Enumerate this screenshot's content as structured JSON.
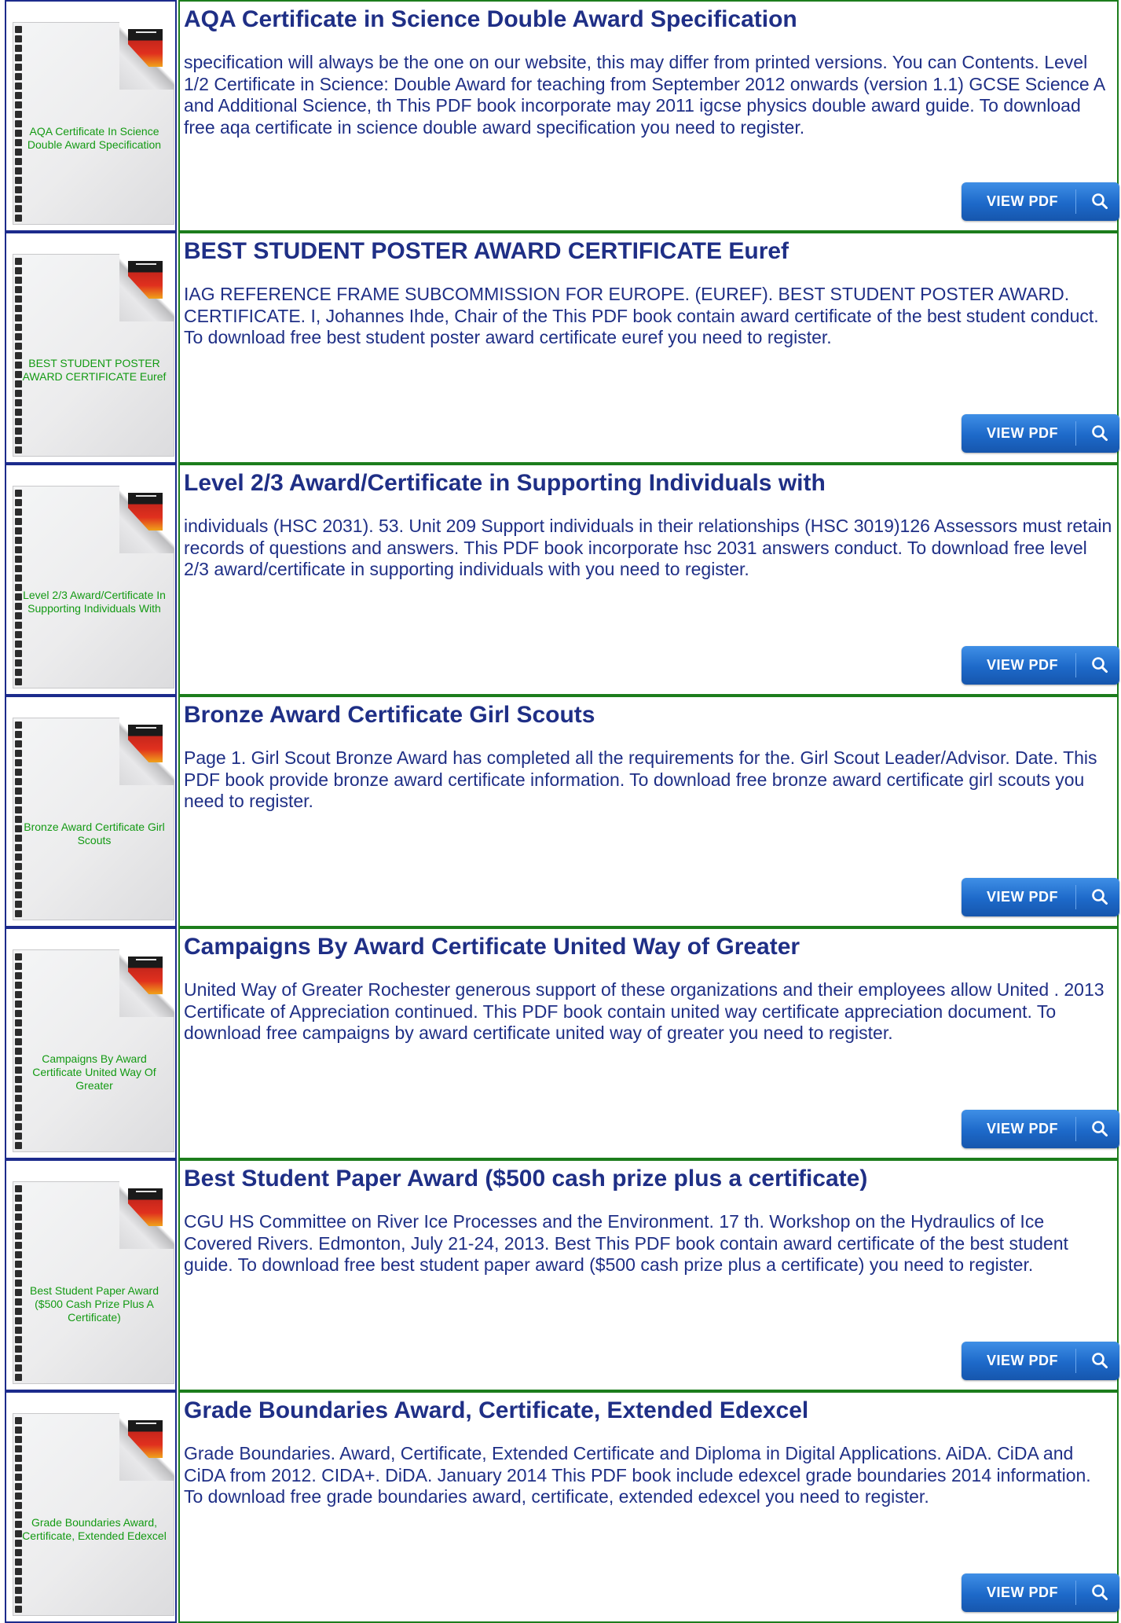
{
  "items": [
    {
      "thumb_title": "AQA Certificate In Science Double Award Specification",
      "title": "AQA Certificate in Science Double Award Specification",
      "description": "specification will always be the one on our website, this may differ from printed versions. You can Contents. Level 1/2 Certificate in Science: Double Award for teaching from September 2012 onwards (version 1.1) GCSE Science A and Additional Science, th This PDF book incorporate may 2011 igcse physics double award guide. To download free aqa certificate in science double award specification you need to register.",
      "button_label": "VIEW PDF"
    },
    {
      "thumb_title": "BEST STUDENT POSTER AWARD CERTIFICATE Euref",
      "title": "BEST STUDENT POSTER AWARD CERTIFICATE Euref",
      "description": "IAG REFERENCE FRAME SUBCOMMISSION FOR EUROPE. (EUREF). BEST STUDENT POSTER AWARD. CERTIFICATE. I, Johannes Ihde, Chair of the  This PDF book contain award certificate of the best student conduct. To download free best student poster award certificate euref you need to register.",
      "button_label": "VIEW PDF"
    },
    {
      "thumb_title": "Level 2/3 Award/Certificate In Supporting Individuals With",
      "title": "Level 2/3 Award/Certificate in Supporting Individuals with",
      "description": "individuals (HSC 2031). 53. Unit 209 Support individuals in their relationships (HSC 3019)126 Assessors must retain records of questions and answers. This PDF book incorporate hsc 2031 answers conduct. To download free level 2/3 award/certificate in supporting individuals with you need to register.",
      "button_label": "VIEW PDF"
    },
    {
      "thumb_title": "Bronze Award Certificate Girl Scouts",
      "title": "Bronze Award Certificate Girl Scouts",
      "description": "Page 1. Girl Scout Bronze Award has completed all the requirements for the. Girl Scout Leader/Advisor. Date. This PDF book provide bronze award certificate information. To download free bronze award certificate girl scouts you need to register.",
      "button_label": "VIEW PDF"
    },
    {
      "thumb_title": "Campaigns By Award Certificate United Way Of Greater",
      "title": "Campaigns By Award Certificate United Way of Greater",
      "description": "United Way of Greater Rochester generous support of these organizations and their employees allow United . 2013 Certificate of Appreciation continued. This PDF book contain united way certificate appreciation document. To download free campaigns by award certificate united way of greater you need to register.",
      "button_label": "VIEW PDF"
    },
    {
      "thumb_title": "Best Student Paper Award ($500 Cash Prize Plus A Certificate)",
      "title": "Best Student Paper Award ($500 cash prize plus a certificate)",
      "description": "CGU HS Committee on River Ice Processes and the Environment. 17 th. Workshop on the Hydraulics of Ice Covered Rivers. Edmonton, July 21-24, 2013. Best  This PDF book contain award certificate of the best student guide. To download free best student paper award ($500 cash prize plus a certificate) you need to register.",
      "button_label": "VIEW PDF"
    },
    {
      "thumb_title": "Grade Boundaries Award, Certificate, Extended Edexcel",
      "title": "Grade Boundaries Award, Certificate, Extended Edexcel",
      "description": "Grade Boundaries. Award, Certificate, Extended Certificate and Diploma in Digital Applications. AiDA. CiDA and CiDA from 2012. CIDA+. DiDA. January 2014  This PDF book include edexcel grade boundaries 2014 information. To download free grade boundaries award, certificate, extended edexcel you need to register.",
      "button_label": "VIEW PDF"
    }
  ]
}
